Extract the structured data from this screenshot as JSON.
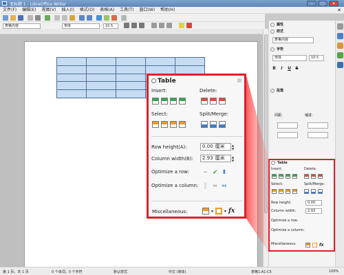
{
  "window": {
    "title": "无标题 1 - LibreOffice Writer",
    "minimize": "–",
    "maximize": "□",
    "close": "✕"
  },
  "menu": [
    "文件(F)",
    "编辑(E)",
    "视图(V)",
    "插入(I)",
    "格式(O)",
    "表格(A)",
    "工具(T)",
    "窗口(W)",
    "帮助(H)"
  ],
  "menu_close_doc": "✕",
  "toolbar2": {
    "style_combo": "表格内容",
    "font_combo": "宋体",
    "size_combo": "10.5"
  },
  "sidebar": {
    "section_properties": "属性",
    "section_style": "样式",
    "style_value": "表格内容",
    "section_character": "字符",
    "font_value": "宋体",
    "size_value": "10.5",
    "format_buttons": [
      "B",
      "I",
      "U",
      "S"
    ],
    "section_paragraph": "段落",
    "spacing_label": "间距:",
    "indent_label": "缩进:"
  },
  "mini_table": {
    "title": "Table",
    "insert": "Insert:",
    "delete": "Delete:",
    "select": "Select:",
    "split_merge": "Split/Merge:",
    "row_height": "Row height:",
    "column_width": "Column width:",
    "row_height_value": "0.00",
    "column_width_value": "2.93",
    "optimize_row": "Optimize a row:",
    "optimize_column": "Optimize a column:",
    "misc": "Miscellaneous:",
    "fx": "fx"
  },
  "zoom_panel": {
    "title": "Table",
    "insert": "Insert:",
    "delete": "Delete:",
    "select": "Select:",
    "split_merge": "Split/Merge:",
    "row_height": "Row height(A):",
    "column_width": "Column width(B):",
    "row_height_value": "0.00",
    "column_width_value": "2.93",
    "unit": "厘米",
    "optimize_row": "Optimize a row:",
    "optimize_column": "Optimize a column:",
    "misc": "Miscellaneous:",
    "fx": "fx"
  },
  "status": {
    "page": "第 1 页，共 1 页",
    "words": "0 个单词，0 个字符",
    "style": "默认样式",
    "language": "中文 (简体)",
    "cell": "表格1:A1:C5",
    "zoom": "100%"
  }
}
